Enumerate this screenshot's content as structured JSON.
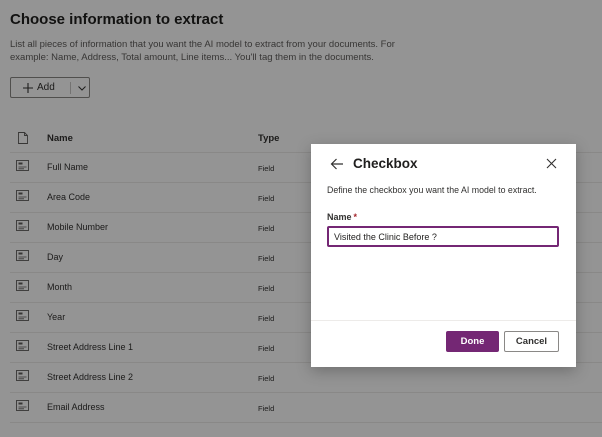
{
  "page": {
    "title": "Choose information to extract",
    "description": "List all pieces of information that you want the AI model to extract from your documents. For example: Name, Address, Total amount, Line items... You'll tag them in the documents."
  },
  "toolbar": {
    "add_label": "Add",
    "add_icon": "plus-icon",
    "dropdown_icon": "chevron-down-icon"
  },
  "table": {
    "header_icon": "document-icon",
    "columns": {
      "name": "Name",
      "type": "Type"
    },
    "rows": [
      {
        "name": "Full Name",
        "type": "Field"
      },
      {
        "name": "Area Code",
        "type": "Field"
      },
      {
        "name": "Mobile Number",
        "type": "Field"
      },
      {
        "name": "Day",
        "type": "Field"
      },
      {
        "name": "Month",
        "type": "Field"
      },
      {
        "name": "Year",
        "type": "Field"
      },
      {
        "name": "Street Address Line 1",
        "type": "Field"
      },
      {
        "name": "Street Address Line 2",
        "type": "Field"
      },
      {
        "name": "Email Address",
        "type": "Field"
      }
    ]
  },
  "dialog": {
    "title": "Checkbox",
    "description": "Define the checkbox you want the AI model to extract.",
    "name_label": "Name",
    "required_marker": "*",
    "name_value": "Visited the Clinic Before ?",
    "done_label": "Done",
    "cancel_label": "Cancel",
    "back_icon": "arrow-left-icon",
    "close_icon": "close-icon"
  },
  "colors": {
    "accent": "#742774",
    "overlay": "rgba(0,0,0,0.42)",
    "required": "#a4262c"
  }
}
